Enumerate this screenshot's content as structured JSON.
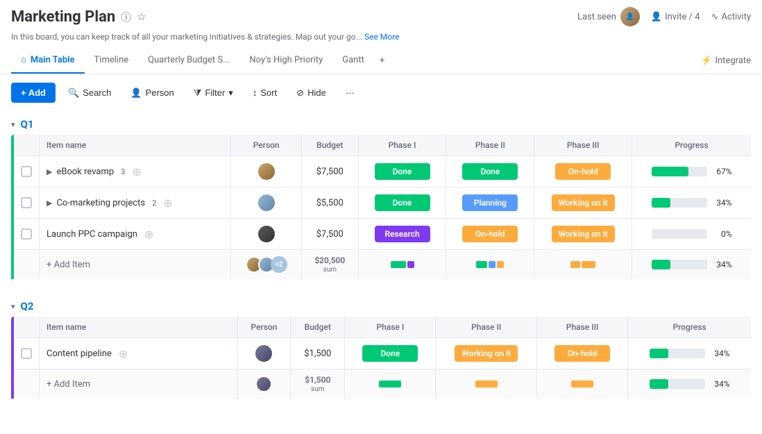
{
  "header": {
    "title": "Marketing Plan",
    "description": "In this board, you can keep track of all your marketing initiatives & strategies. Map out your go...",
    "see_more": "See More",
    "last_seen_label": "Last seen",
    "invite_label": "Invite / 4",
    "activity_label": "Activity"
  },
  "tabs": [
    {
      "id": "main-table",
      "label": "Main Table",
      "active": true,
      "icon": "home"
    },
    {
      "id": "timeline",
      "label": "Timeline",
      "active": false
    },
    {
      "id": "quarterly-budget",
      "label": "Quarterly Budget S...",
      "active": false
    },
    {
      "id": "noys-high-priority",
      "label": "Noy's High Priority",
      "active": false
    },
    {
      "id": "gantt",
      "label": "Gantt",
      "active": false
    }
  ],
  "tab_add": "+",
  "integrate_label": "Integrate",
  "toolbar": {
    "add_label": "+ Add",
    "search_label": "Search",
    "person_label": "Person",
    "filter_label": "Filter",
    "sort_label": "Sort",
    "hide_label": "Hide",
    "more_label": "···"
  },
  "groups": [
    {
      "id": "q1",
      "name": "Q1",
      "color": "#00c875",
      "columns": [
        "Item name",
        "Person",
        "Budget",
        "Phase I",
        "Phase II",
        "Phase III",
        "Progress"
      ],
      "rows": [
        {
          "id": "ebook-revamp",
          "name": "eBook revamp",
          "sub_count": "3",
          "person_count": 1,
          "budget": "$7,500",
          "phase1": "Done",
          "phase1_class": "status-done",
          "phase2": "Done",
          "phase2_class": "status-done",
          "phase3": "On-hold",
          "phase3_class": "status-on-hold",
          "progress": 67,
          "has_expand": true
        },
        {
          "id": "co-marketing",
          "name": "Co-marketing projects",
          "sub_count": "2",
          "person_count": 1,
          "budget": "$5,500",
          "phase1": "Done",
          "phase1_class": "status-done",
          "phase2": "Planning",
          "phase2_class": "status-planning",
          "phase3": "Working on it",
          "phase3_class": "status-working",
          "progress": 34,
          "has_expand": true
        },
        {
          "id": "launch-ppc",
          "name": "Launch PPC campaign",
          "sub_count": "",
          "person_count": 1,
          "budget": "$7,500",
          "phase1": "Research",
          "phase1_class": "status-research",
          "phase2": "On-hold",
          "phase2_class": "status-on-hold",
          "phase3": "Working on it",
          "phase3_class": "status-working",
          "progress": 0,
          "has_expand": false
        }
      ],
      "summary": {
        "budget": "$20,500",
        "budget_sub": "sum",
        "progress": 34
      }
    },
    {
      "id": "q2",
      "name": "Q2",
      "color": "#7e3af2",
      "columns": [
        "Item name",
        "Person",
        "Budget",
        "Phase I",
        "Phase II",
        "Phase III",
        "Progress"
      ],
      "rows": [
        {
          "id": "content-pipeline",
          "name": "Content pipeline",
          "sub_count": "",
          "person_count": 1,
          "budget": "$1,500",
          "phase1": "Done",
          "phase1_class": "status-done",
          "phase2": "Working on it",
          "phase2_class": "status-working",
          "phase3": "On-hold",
          "phase3_class": "status-on-hold",
          "progress": 34,
          "has_expand": false
        }
      ],
      "summary": {
        "budget": "$1,500",
        "budget_sub": "sum",
        "progress": 34
      }
    }
  ],
  "add_item_label": "+ Add Item"
}
